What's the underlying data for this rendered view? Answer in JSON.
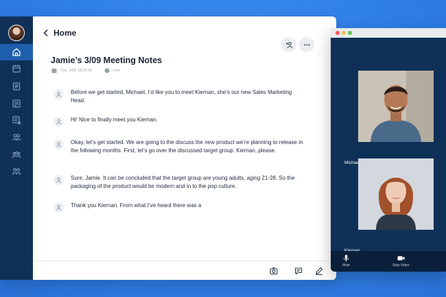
{
  "header": {
    "back_label": "Home"
  },
  "note": {
    "title": "Jamie’s 3/09 Meeting Notes",
    "date": "Tue, 3/09 18:15:20",
    "status": "Live"
  },
  "messages": [
    {
      "text": "Before we get started, Michael, I’d like you to meet Kiernan, she’s our new Sales Marketing Head."
    },
    {
      "text": "Hi! Nice to finally meet you Kiernan."
    },
    {
      "text": "Okay, let’s get started. We are going to the discuss the new product we’re planning to release in the following months. First, let’s go over the discussed target group. Kiernan, please."
    },
    {
      "text": "Sure, Jamie. It can be concluded that the target group are young adults, aging 21-28. So the packaging of the product would be modern and in to the pop culture."
    },
    {
      "text": "Thank you Kiernan. From what I’ve heard there was a"
    }
  ],
  "call": {
    "participants": [
      {
        "name": "Michael"
      },
      {
        "name": "Kiernan"
      }
    ],
    "controls": {
      "mute_label": "Mute",
      "stop_video_label": "Stop Video"
    }
  },
  "colors": {
    "background": "#2f7fe8",
    "rail": "#0f3158",
    "rail_active": "#1e5fae",
    "call_bg": "#123a68"
  }
}
